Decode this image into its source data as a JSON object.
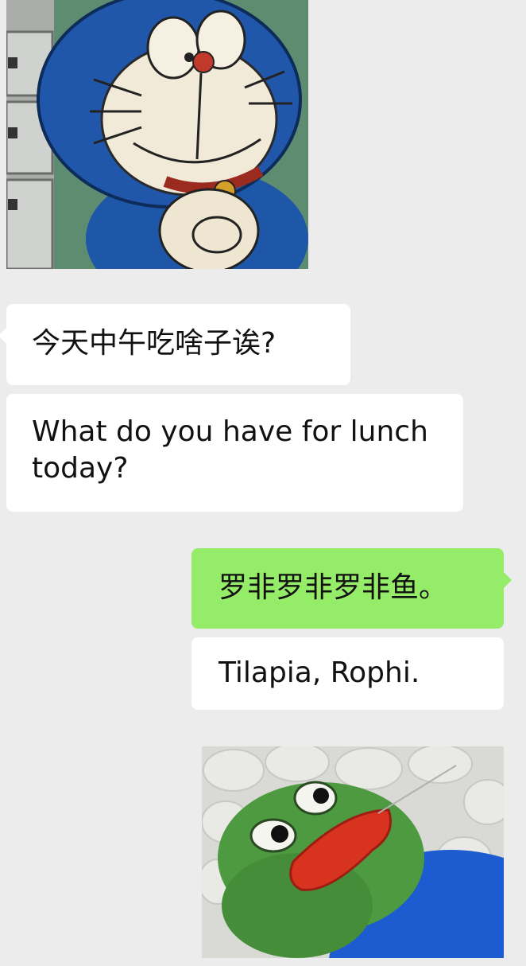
{
  "chat": {
    "stickers": {
      "incoming": "doraemon-sticker",
      "outgoing": "pepe-frog-sticker"
    },
    "messages": [
      {
        "side": "left",
        "text": "今天中午吃啥子诶?"
      },
      {
        "side": "left",
        "text": "What do you have for lunch today?"
      },
      {
        "side": "right",
        "text": "罗非罗非罗非鱼。"
      },
      {
        "side": "right",
        "text": "Tilapia, Rophi."
      }
    ]
  },
  "colors": {
    "background": "#ececec",
    "bubble_incoming": "#ffffff",
    "bubble_outgoing": "#95ec69",
    "text": "#111111"
  }
}
